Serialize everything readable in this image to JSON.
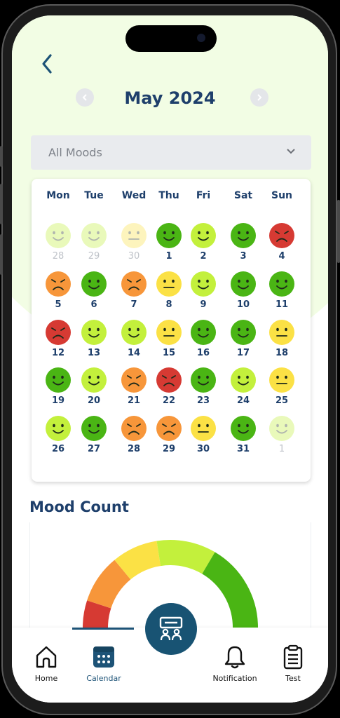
{
  "header": {
    "month_title": "May 2024"
  },
  "filter": {
    "selected": "All Moods"
  },
  "calendar": {
    "weekdays": [
      "Mon",
      "Tue",
      "Wed",
      "Thu",
      "Fri",
      "Sat",
      "Sun"
    ],
    "days": [
      {
        "n": "28",
        "mood": "good",
        "muted": true
      },
      {
        "n": "29",
        "mood": "okay",
        "muted": true
      },
      {
        "n": "30",
        "mood": "neutral",
        "muted": true
      },
      {
        "n": "1",
        "mood": "great"
      },
      {
        "n": "2",
        "mood": "good"
      },
      {
        "n": "3",
        "mood": "great"
      },
      {
        "n": "4",
        "mood": "awful"
      },
      {
        "n": "5",
        "mood": "bad"
      },
      {
        "n": "6",
        "mood": "great"
      },
      {
        "n": "7",
        "mood": "bad"
      },
      {
        "n": "8",
        "mood": "neutral"
      },
      {
        "n": "9",
        "mood": "good"
      },
      {
        "n": "10",
        "mood": "great"
      },
      {
        "n": "11",
        "mood": "great"
      },
      {
        "n": "12",
        "mood": "awful"
      },
      {
        "n": "13",
        "mood": "good"
      },
      {
        "n": "14",
        "mood": "good"
      },
      {
        "n": "15",
        "mood": "neutral"
      },
      {
        "n": "16",
        "mood": "great"
      },
      {
        "n": "17",
        "mood": "great"
      },
      {
        "n": "18",
        "mood": "neutral"
      },
      {
        "n": "19",
        "mood": "great"
      },
      {
        "n": "20",
        "mood": "good"
      },
      {
        "n": "21",
        "mood": "bad"
      },
      {
        "n": "22",
        "mood": "awful"
      },
      {
        "n": "23",
        "mood": "great"
      },
      {
        "n": "24",
        "mood": "good"
      },
      {
        "n": "25",
        "mood": "neutral"
      },
      {
        "n": "26",
        "mood": "good"
      },
      {
        "n": "27",
        "mood": "great"
      },
      {
        "n": "28",
        "mood": "bad"
      },
      {
        "n": "29",
        "mood": "bad"
      },
      {
        "n": "30",
        "mood": "neutral"
      },
      {
        "n": "31",
        "mood": "great"
      },
      {
        "n": "1",
        "mood": "good",
        "muted": true
      }
    ]
  },
  "mood_count": {
    "title": "Mood Count",
    "segments": [
      {
        "mood": "awful",
        "color": "#d63a33",
        "share": 0.1
      },
      {
        "mood": "bad",
        "color": "#f7963a",
        "share": 0.18
      },
      {
        "mood": "neutral",
        "color": "#fbe145",
        "share": 0.17
      },
      {
        "mood": "good",
        "color": "#c3f03c",
        "share": 0.22
      },
      {
        "mood": "great",
        "color": "#4ab514",
        "share": 0.33
      }
    ]
  },
  "mood_colors": {
    "great": "#4ab514",
    "good": "#c3f03c",
    "okay": "#c3f03c",
    "neutral": "#fbe145",
    "bad": "#f7963a",
    "awful": "#d63a33"
  },
  "nav": {
    "home": "Home",
    "calendar": "Calendar",
    "notification": "Notification",
    "test": "Test"
  }
}
